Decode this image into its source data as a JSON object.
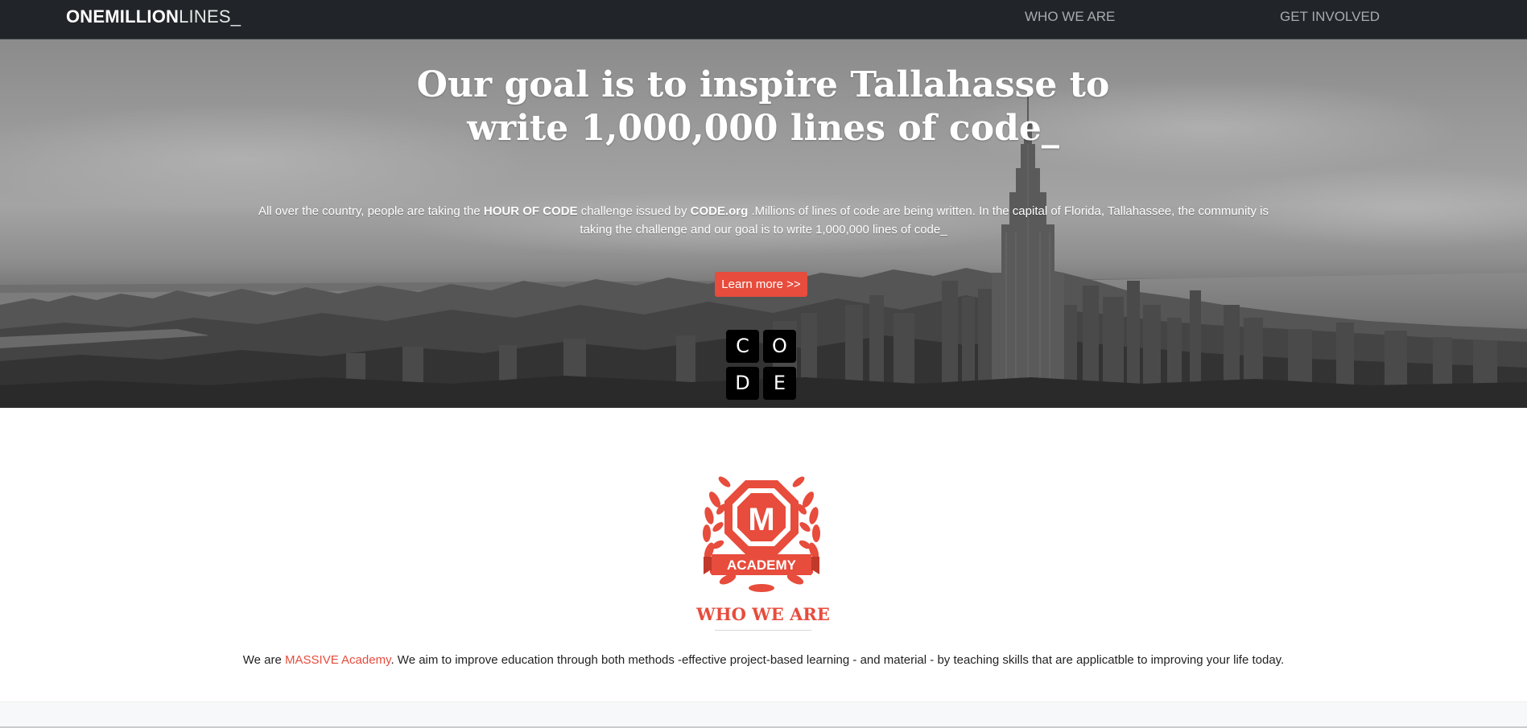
{
  "navbar": {
    "brand_bold": "ONEMILLION",
    "brand_light": "LINES_",
    "links": [
      {
        "label": "WHO WE ARE"
      },
      {
        "label": "GET INVOLVED"
      }
    ]
  },
  "hero": {
    "title": "Our goal is to inspire Tallahasse to write 1,000,000 lines of code_",
    "text": {
      "part1": "All over the country, people are taking the ",
      "hour_of_code": "HOUR OF CODE",
      "part2": " challenge issued by ",
      "code_org": "CODE.org",
      "part3": " .Millions of lines of code are being written. In the capital of Florida, Tallahassee, the community is taking the challenge and our goal is to write 1,000,000 lines of code_"
    },
    "button_label": "Learn more >>",
    "code_logo_letters": [
      "C",
      "O",
      "D",
      "E"
    ]
  },
  "who": {
    "logo_letter": "M",
    "logo_banner": "ACADEMY",
    "title": "WHO WE ARE",
    "text_prefix": "We are ",
    "text_link": "MASSIVE Academy",
    "text_suffix": ". We aim to improve education through both methods -effective project-based learning - and material - by teaching skills that are applicatble to improving your life today."
  },
  "colors": {
    "navbar_bg": "#212529",
    "accent": "#e74c3c",
    "nav_link": "#a9abad"
  }
}
